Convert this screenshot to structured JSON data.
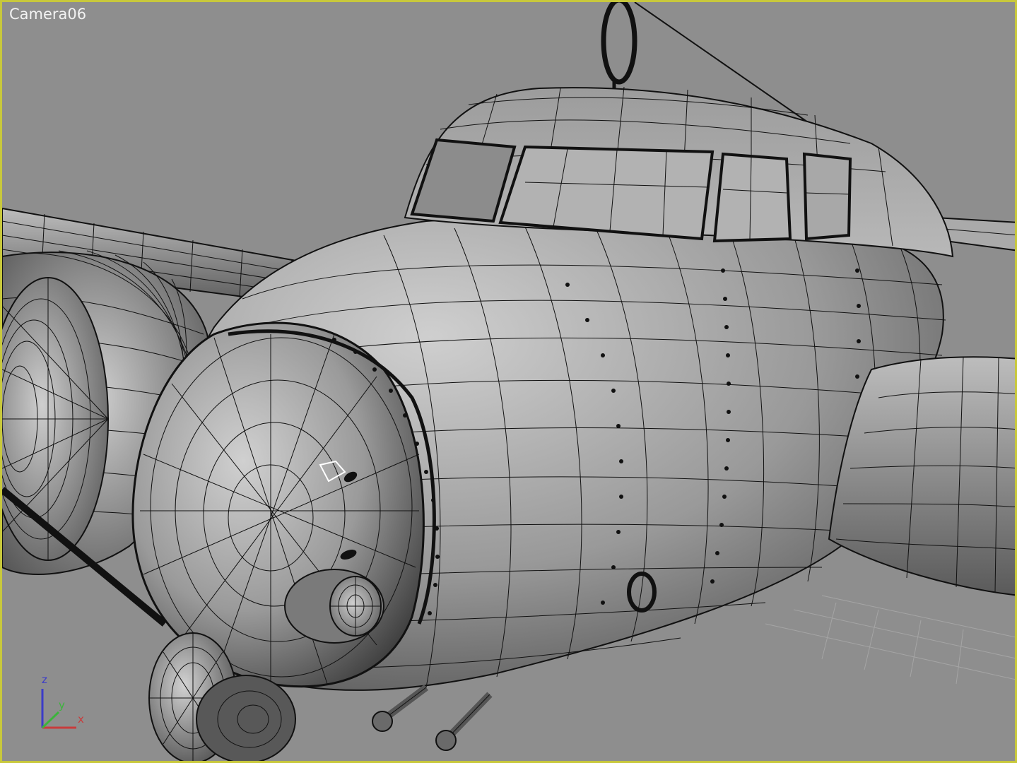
{
  "viewport": {
    "label": "Camera06",
    "border_color": "#c8c83c",
    "background": "#8e8e8e",
    "mode": "wireframe-on-shaded"
  },
  "axis_gizmo": {
    "z_label": "z",
    "y_label": "y",
    "x_label": "x",
    "z_color": "#3c3cc8",
    "y_color": "#3cb43c",
    "x_color": "#c83c3c"
  },
  "model": {
    "wire_color": "#000000",
    "shade_light": "#bdbdbd",
    "shade_dark": "#3c3c3c",
    "icon": "aircraft-model-icon"
  }
}
